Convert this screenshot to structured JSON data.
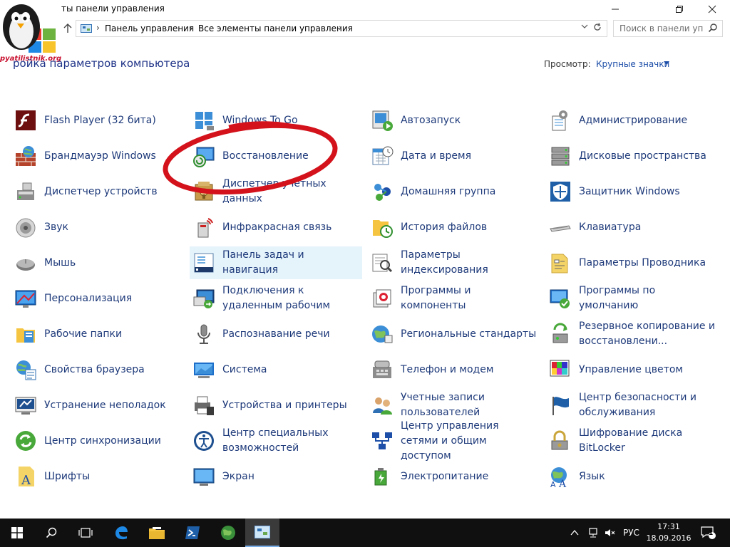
{
  "window": {
    "title": "Все элементы панели управления",
    "title_visible": "ты панели управления"
  },
  "logo": {
    "text": "pyatilistnik.org"
  },
  "address": {
    "crumbs": [
      "Панель управления",
      "Все элементы панели управления"
    ],
    "search_placeholder": "Поиск в панели уп..."
  },
  "header": {
    "title": "Настройка параметров компьютера",
    "title_visible": "ройка параметров компьютера",
    "view_label": "Просмотр:",
    "view_value": "Крупные значки"
  },
  "items": [
    {
      "label": "Flash Player (32 бита)",
      "icon": "flash-player-icon"
    },
    {
      "label": "Брандмауэр Windows",
      "icon": "firewall-icon"
    },
    {
      "label": "Диспетчер устройств",
      "icon": "device-manager-icon"
    },
    {
      "label": "Звук",
      "icon": "sound-icon"
    },
    {
      "label": "Мышь",
      "icon": "mouse-icon"
    },
    {
      "label": "Персонализация",
      "icon": "personalization-icon"
    },
    {
      "label": "Рабочие папки",
      "icon": "work-folders-icon"
    },
    {
      "label": "Свойства браузера",
      "icon": "browser-properties-icon"
    },
    {
      "label": "Устранение неполадок",
      "icon": "troubleshooting-icon"
    },
    {
      "label": "Центр синхронизации",
      "icon": "sync-center-icon"
    },
    {
      "label": "Шрифты",
      "icon": "fonts-icon"
    },
    {
      "label": "Windows To Go",
      "icon": "windows-to-go-icon"
    },
    {
      "label": "Восстановление",
      "icon": "recovery-icon"
    },
    {
      "label": "Диспетчер учетных данных",
      "icon": "credential-manager-icon"
    },
    {
      "label": "Инфракрасная связь",
      "icon": "infrared-icon"
    },
    {
      "label": "Панель задач и навигация",
      "icon": "taskbar-navigation-icon"
    },
    {
      "label": "Подключения к удаленным рабочим",
      "icon": "remote-desktop-icon"
    },
    {
      "label": "Распознавание речи",
      "icon": "speech-recognition-icon"
    },
    {
      "label": "Система",
      "icon": "system-icon"
    },
    {
      "label": "Устройства и принтеры",
      "icon": "devices-printers-icon"
    },
    {
      "label": "Центр специальных возможностей",
      "icon": "ease-of-access-icon"
    },
    {
      "label": "Экран",
      "icon": "display-icon"
    },
    {
      "label": "Автозапуск",
      "icon": "autoplay-icon"
    },
    {
      "label": "Дата и время",
      "icon": "date-time-icon"
    },
    {
      "label": "Домашняя группа",
      "icon": "homegroup-icon"
    },
    {
      "label": "История файлов",
      "icon": "file-history-icon"
    },
    {
      "label": "Параметры индексирования",
      "icon": "indexing-options-icon"
    },
    {
      "label": "Программы и компоненты",
      "icon": "programs-features-icon"
    },
    {
      "label": "Региональные стандарты",
      "icon": "region-icon"
    },
    {
      "label": "Телефон и модем",
      "icon": "phone-modem-icon"
    },
    {
      "label": "Учетные записи пользователей",
      "icon": "user-accounts-icon"
    },
    {
      "label": "Центр управления сетями и общим доступом",
      "icon": "network-sharing-icon"
    },
    {
      "label": "Электропитание",
      "icon": "power-options-icon"
    },
    {
      "label": "Администрирование",
      "icon": "administrative-tools-icon"
    },
    {
      "label": "Дисковые пространства",
      "icon": "storage-spaces-icon"
    },
    {
      "label": "Защитник Windows",
      "icon": "windows-defender-icon"
    },
    {
      "label": "Клавиатура",
      "icon": "keyboard-icon"
    },
    {
      "label": "Параметры Проводника",
      "icon": "explorer-options-icon"
    },
    {
      "label": "Программы по умолчанию",
      "icon": "default-programs-icon"
    },
    {
      "label": "Резервное копирование и восстановлени...",
      "icon": "backup-restore-icon"
    },
    {
      "label": "Управление цветом",
      "icon": "color-management-icon"
    },
    {
      "label": "Центр безопасности и обслуживания",
      "icon": "security-maintenance-icon"
    },
    {
      "label": "Шифрование диска BitLocker",
      "icon": "bitlocker-icon"
    },
    {
      "label": "Язык",
      "icon": "language-icon"
    }
  ],
  "taskbar": {
    "language": "РУС",
    "time": "17:31",
    "date": "18.09.2016",
    "notifications": "1"
  }
}
